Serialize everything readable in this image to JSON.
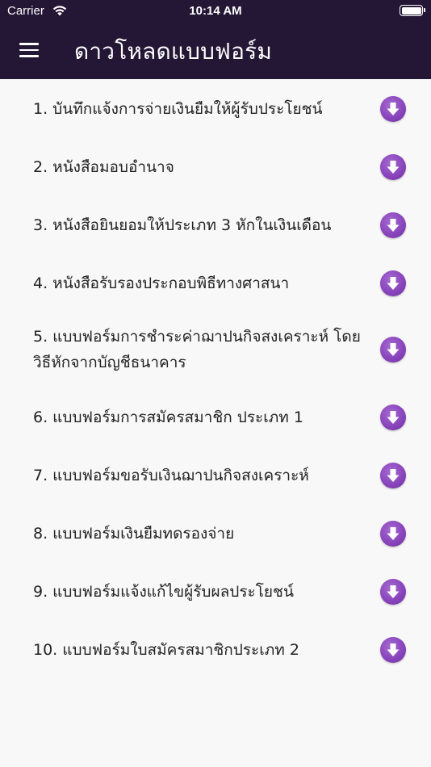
{
  "status_bar": {
    "carrier": "Carrier",
    "time": "10:14 AM"
  },
  "header": {
    "title": "ดาวโหลดแบบฟอร์ม",
    "background": "#241635"
  },
  "accent_color": "#8a45bd",
  "forms": [
    {
      "label": "1. บันทึกแจ้งการจ่ายเงินยืมให้ผู้รับประโยชน์"
    },
    {
      "label": "2. หนังสือมอบอำนาจ"
    },
    {
      "label": "3. หนังสือยินยอมให้ประเภท 3 หักในเงินเดือน"
    },
    {
      "label": "4. หนังสือรับรองประกอบพิธีทางศาสนา"
    },
    {
      "label": "5. แบบฟอร์มการชำระค่าฌาปนกิจสงเคราะห์ โดยวิธีหักจากบัญชีธนาคาร"
    },
    {
      "label": "6. แบบฟอร์มการสมัครสมาชิก ประเภท 1"
    },
    {
      "label": "7. แบบฟอร์มขอรับเงินฌาปนกิจสงเคราะห์"
    },
    {
      "label": "8. แบบฟอร์มเงินยืมทดรองจ่าย"
    },
    {
      "label": "9. แบบฟอร์มแจ้งแก้ไขผู้รับผลประโยชน์"
    },
    {
      "label": "10. แบบฟอร์มใบสมัครสมาชิกประเภท 2"
    }
  ]
}
